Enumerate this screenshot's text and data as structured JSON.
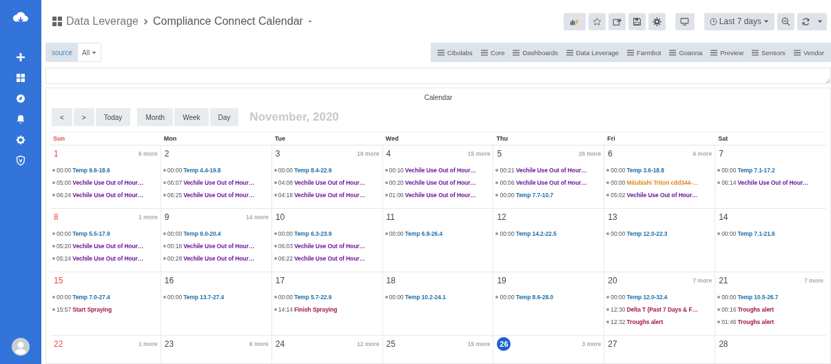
{
  "breadcrumb": {
    "parent": "Data Leverage",
    "title": "Compliance Connect Calendar"
  },
  "toolbar": {
    "time_range": "Last 7 days"
  },
  "filter": {
    "label": "source",
    "value": "All"
  },
  "dashboard_links": [
    "Cibolabs",
    "Core",
    "Dashboards",
    "Data Leverage",
    "Farmbot",
    "Goanna",
    "Preview",
    "Sensors",
    "Vendor"
  ],
  "calendar": {
    "panel_title": "Calendar",
    "nav_buttons": [
      "<",
      ">",
      "Today"
    ],
    "views": [
      "Month",
      "Week",
      "Day"
    ],
    "month_title": "November, 2020",
    "weekdays": [
      "Sun",
      "Mon",
      "Tue",
      "Wed",
      "Thu",
      "Fri",
      "Sat"
    ],
    "weeks": [
      {
        "days": [
          {
            "day": "1",
            "more": "6 more",
            "today": false,
            "events": [
              {
                "time": "00:00",
                "title": "Temp 9.6-18.6",
                "color": "#1f6fa8"
              },
              {
                "time": "05:00",
                "title": "Vechile Use Out of Hour…",
                "color": "#6a1b9a"
              },
              {
                "time": "06:24",
                "title": "Vechile Use Out of Hour…",
                "color": "#6a1b9a"
              }
            ]
          },
          {
            "day": "2",
            "today": false,
            "events": [
              {
                "time": "00:00",
                "title": "Temp 4.4-19.8",
                "color": "#1f6fa8"
              },
              {
                "time": "06:07",
                "title": "Vechile Use Out of Hour…",
                "color": "#6a1b9a"
              },
              {
                "time": "06:25",
                "title": "Vechile Use Out of Hour…",
                "color": "#6a1b9a"
              }
            ]
          },
          {
            "day": "3",
            "more": "19 more",
            "today": false,
            "events": [
              {
                "time": "00:00",
                "title": "Temp 8.4-22.9",
                "color": "#1f6fa8"
              },
              {
                "time": "04:08",
                "title": "Vechile Use Out of Hour…",
                "color": "#6a1b9a"
              },
              {
                "time": "04:18",
                "title": "Vechile Use Out of Hour…",
                "color": "#6a1b9a"
              }
            ]
          },
          {
            "day": "4",
            "more": "15 more",
            "today": false,
            "events": [
              {
                "time": "00:10",
                "title": "Vechile Use Out of Hour…",
                "color": "#6a1b9a"
              },
              {
                "time": "00:20",
                "title": "Vechile Use Out of Hour…",
                "color": "#6a1b9a"
              },
              {
                "time": "01:00",
                "title": "Vechile Use Out of Hour…",
                "color": "#6a1b9a"
              }
            ]
          },
          {
            "day": "5",
            "more": "26 more",
            "today": false,
            "events": [
              {
                "time": "00:21",
                "title": "Vechile Use Out of Hour…",
                "color": "#6a1b9a"
              },
              {
                "time": "00:06",
                "title": "Vechile Use Out of Hour…",
                "color": "#6a1b9a"
              },
              {
                "time": "00:00",
                "title": "Temp 7.7-10.7",
                "color": "#1f6fa8"
              }
            ]
          },
          {
            "day": "6",
            "more": "4 more",
            "today": false,
            "events": [
              {
                "time": "00:00",
                "title": "Temp 3.6-18.8",
                "color": "#1f6fa8"
              },
              {
                "time": "00:00",
                "title": "Mitubishi Triton cdd344-…",
                "color": "#e0861c"
              },
              {
                "time": "05:02",
                "title": "Vechile Use Out of Hour…",
                "color": "#6a1b9a"
              }
            ]
          },
          {
            "day": "7",
            "today": false,
            "events": [
              {
                "time": "00:00",
                "title": "Temp 7.1-17.2",
                "color": "#1f6fa8"
              },
              {
                "time": "06:14",
                "title": "Vechile Use Out of Hour…",
                "color": "#6a1b9a"
              }
            ]
          }
        ]
      },
      {
        "days": [
          {
            "day": "8",
            "more": "1 more",
            "today": false,
            "events": [
              {
                "time": "00:00",
                "title": "Temp 5.5-17.9",
                "color": "#1f6fa8"
              },
              {
                "time": "05:20",
                "title": "Vechile Use Out of Hour…",
                "color": "#6a1b9a"
              },
              {
                "time": "05:24",
                "title": "Vechile Use Out of Hour…",
                "color": "#6a1b9a"
              }
            ]
          },
          {
            "day": "9",
            "more": "14 more",
            "today": false,
            "events": [
              {
                "time": "00:00",
                "title": "Temp 9.0-20.4",
                "color": "#1f6fa8"
              },
              {
                "time": "00:18",
                "title": "Vechile Use Out of Hour…",
                "color": "#6a1b9a"
              },
              {
                "time": "00:28",
                "title": "Vechile Use Out of Hour…",
                "color": "#6a1b9a"
              }
            ]
          },
          {
            "day": "10",
            "today": false,
            "events": [
              {
                "time": "00:00",
                "title": "Temp 6.3-23.9",
                "color": "#1f6fa8"
              },
              {
                "time": "06:03",
                "title": "Vechile Use Out of Hour…",
                "color": "#6a1b9a"
              },
              {
                "time": "06:22",
                "title": "Vechile Use Out of Hour…",
                "color": "#6a1b9a"
              }
            ]
          },
          {
            "day": "11",
            "today": false,
            "events": [
              {
                "time": "00:00",
                "title": "Temp 6.8-26.4",
                "color": "#1f6fa8"
              }
            ]
          },
          {
            "day": "12",
            "today": false,
            "events": [
              {
                "time": "00:00",
                "title": "Temp 14.2-22.5",
                "color": "#1f6fa8"
              }
            ]
          },
          {
            "day": "13",
            "today": false,
            "events": [
              {
                "time": "00:00",
                "title": "Temp 12.0-22.3",
                "color": "#1f6fa8"
              }
            ]
          },
          {
            "day": "14",
            "today": false,
            "events": [
              {
                "time": "00:00",
                "title": "Temp 7.1-21.6",
                "color": "#1f6fa8"
              }
            ]
          }
        ]
      },
      {
        "days": [
          {
            "day": "15",
            "today": false,
            "events": [
              {
                "time": "00:00",
                "title": "Temp 7.0-27.4",
                "color": "#1f6fa8"
              },
              {
                "time": "15:57",
                "title": "Start Spraying",
                "color": "#a3154f"
              }
            ]
          },
          {
            "day": "16",
            "today": false,
            "events": [
              {
                "time": "00:00",
                "title": "Temp 13.7-27.4",
                "color": "#1f6fa8"
              }
            ]
          },
          {
            "day": "17",
            "today": false,
            "events": [
              {
                "time": "00:00",
                "title": "Temp 5.7-22.9",
                "color": "#1f6fa8"
              },
              {
                "time": "14:14",
                "title": "Finish Spraying",
                "color": "#a3154f"
              }
            ]
          },
          {
            "day": "18",
            "today": false,
            "events": [
              {
                "time": "00:00",
                "title": "Temp 10.2-24.1",
                "color": "#1f6fa8"
              }
            ]
          },
          {
            "day": "19",
            "today": false,
            "events": [
              {
                "time": "00:00",
                "title": "Temp 8.6-28.0",
                "color": "#1f6fa8"
              }
            ]
          },
          {
            "day": "20",
            "more": "7 more",
            "today": false,
            "events": [
              {
                "time": "00:00",
                "title": "Temp 12.0-32.4",
                "color": "#1f6fa8"
              },
              {
                "time": "12:30",
                "title": "Delta T (Past 7 Days & F…",
                "color": "#a3154f"
              },
              {
                "time": "12:32",
                "title": "Troughs alert",
                "color": "#a3154f"
              }
            ]
          },
          {
            "day": "21",
            "more": "7 more",
            "today": false,
            "events": [
              {
                "time": "00:00",
                "title": "Temp 10.5-26.7",
                "color": "#1f6fa8"
              },
              {
                "time": "00:16",
                "title": "Troughs alert",
                "color": "#a3154f"
              },
              {
                "time": "01:46",
                "title": "Troughs alert",
                "color": "#a3154f"
              }
            ]
          }
        ]
      },
      {
        "days": [
          {
            "day": "22",
            "more": "1 more",
            "today": false
          },
          {
            "day": "23",
            "more": "9 more",
            "today": false
          },
          {
            "day": "24",
            "more": "12 more",
            "today": false
          },
          {
            "day": "25",
            "more": "15 more",
            "today": false
          },
          {
            "day": "26",
            "more": "3 more",
            "today": true
          },
          {
            "day": "27",
            "today": false
          },
          {
            "day": "28",
            "today": false
          }
        ]
      }
    ]
  }
}
